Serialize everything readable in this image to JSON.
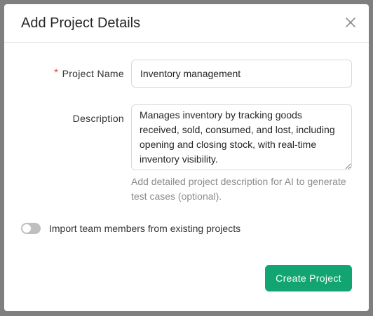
{
  "modal": {
    "title": "Add Project Details",
    "close_icon": "close-icon"
  },
  "form": {
    "project_name": {
      "required_mark": "*",
      "label": "Project Name",
      "value": "Inventory management",
      "placeholder": ""
    },
    "description": {
      "label": "Description",
      "value": "Manages inventory by tracking goods received, sold, consumed, and lost, including opening and closing stock, with real-time inventory visibility.",
      "help_text": "Add detailed project description for AI to generate test cases (optional)."
    },
    "import_members": {
      "label": "Import team members from existing projects",
      "enabled": false
    }
  },
  "footer": {
    "create_label": "Create Project"
  },
  "colors": {
    "primary": "#12a571",
    "required": "#e55353",
    "toggle_off": "#bfbfbf",
    "overlay": "#7f7f7f"
  }
}
